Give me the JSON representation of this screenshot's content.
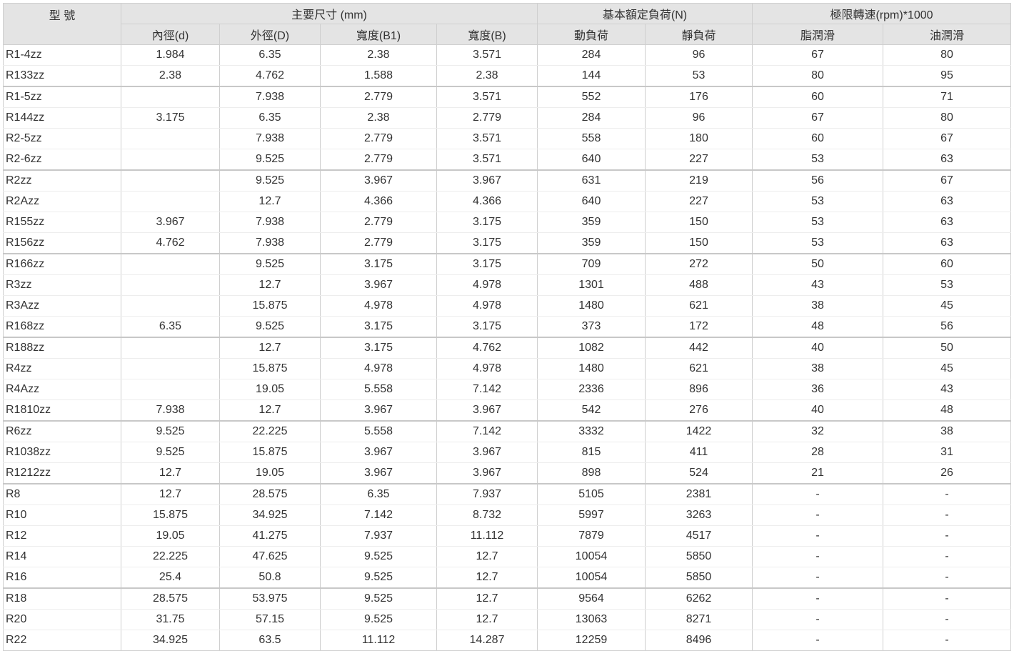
{
  "table": {
    "headers": {
      "model": "型 號",
      "dimensions": "主要尺寸 (mm)",
      "load": "基本額定負荷(N)",
      "speed": "極限轉速(rpm)*1000",
      "inner": "內徑(d)",
      "outer": "外徑(D)",
      "width_b1": "寬度(B1)",
      "width_b": "寬度(B)",
      "dynamic": "動負荷",
      "static": "靜負荷",
      "grease": "脂潤滑",
      "oil": "油潤滑"
    },
    "rows": [
      [
        "R1-4zz",
        "1.984",
        "6.35",
        "2.38",
        "3.571",
        "284",
        "96",
        "67",
        "80"
      ],
      [
        "R133zz",
        "2.38",
        "4.762",
        "1.588",
        "2.38",
        "144",
        "53",
        "80",
        "95"
      ],
      [
        "R1-5zz",
        "",
        "7.938",
        "2.779",
        "3.571",
        "552",
        "176",
        "60",
        "71"
      ],
      [
        "R144zz",
        "3.175",
        "6.35",
        "2.38",
        "2.779",
        "284",
        "96",
        "67",
        "80"
      ],
      [
        "R2-5zz",
        "",
        "7.938",
        "2.779",
        "3.571",
        "558",
        "180",
        "60",
        "67"
      ],
      [
        "R2-6zz",
        "",
        "9.525",
        "2.779",
        "3.571",
        "640",
        "227",
        "53",
        "63"
      ],
      [
        "R2zz",
        "",
        "9.525",
        "3.967",
        "3.967",
        "631",
        "219",
        "56",
        "67"
      ],
      [
        "R2Azz",
        "",
        "12.7",
        "4.366",
        "4.366",
        "640",
        "227",
        "53",
        "63"
      ],
      [
        "R155zz",
        "3.967",
        "7.938",
        "2.779",
        "3.175",
        "359",
        "150",
        "53",
        "63"
      ],
      [
        "R156zz",
        "4.762",
        "7.938",
        "2.779",
        "3.175",
        "359",
        "150",
        "53",
        "63"
      ],
      [
        "R166zz",
        "",
        "9.525",
        "3.175",
        "3.175",
        "709",
        "272",
        "50",
        "60"
      ],
      [
        "R3zz",
        "",
        "12.7",
        "3.967",
        "4.978",
        "1301",
        "488",
        "43",
        "53"
      ],
      [
        "R3Azz",
        "",
        "15.875",
        "4.978",
        "4.978",
        "1480",
        "621",
        "38",
        "45"
      ],
      [
        "R168zz",
        "6.35",
        "9.525",
        "3.175",
        "3.175",
        "373",
        "172",
        "48",
        "56"
      ],
      [
        "R188zz",
        "",
        "12.7",
        "3.175",
        "4.762",
        "1082",
        "442",
        "40",
        "50"
      ],
      [
        "R4zz",
        "",
        "15.875",
        "4.978",
        "4.978",
        "1480",
        "621",
        "38",
        "45"
      ],
      [
        "R4Azz",
        "",
        "19.05",
        "5.558",
        "7.142",
        "2336",
        "896",
        "36",
        "43"
      ],
      [
        "R1810zz",
        "7.938",
        "12.7",
        "3.967",
        "3.967",
        "542",
        "276",
        "40",
        "48"
      ],
      [
        "R6zz",
        "9.525",
        "22.225",
        "5.558",
        "7.142",
        "3332",
        "1422",
        "32",
        "38"
      ],
      [
        "R1038zz",
        "9.525",
        "15.875",
        "3.967",
        "3.967",
        "815",
        "411",
        "28",
        "31"
      ],
      [
        "R1212zz",
        "12.7",
        "19.05",
        "3.967",
        "3.967",
        "898",
        "524",
        "21",
        "26"
      ],
      [
        "R8",
        "12.7",
        "28.575",
        "6.35",
        "7.937",
        "5105",
        "2381",
        "-",
        "-"
      ],
      [
        "R10",
        "15.875",
        "34.925",
        "7.142",
        "8.732",
        "5997",
        "3263",
        "-",
        "-"
      ],
      [
        "R12",
        "19.05",
        "41.275",
        "7.937",
        "11.112",
        "7879",
        "4517",
        "-",
        "-"
      ],
      [
        "R14",
        "22.225",
        "47.625",
        "9.525",
        "12.7",
        "10054",
        "5850",
        "-",
        "-"
      ],
      [
        "R16",
        "25.4",
        "50.8",
        "9.525",
        "12.7",
        "10054",
        "5850",
        "-",
        "-"
      ],
      [
        "R18",
        "28.575",
        "53.975",
        "9.525",
        "12.7",
        "9564",
        "6262",
        "-",
        "-"
      ],
      [
        "R20",
        "31.75",
        "57.15",
        "9.525",
        "12.7",
        "13063",
        "8271",
        "-",
        "-"
      ],
      [
        "R22",
        "34.925",
        "63.5",
        "11.112",
        "14.287",
        "12259",
        "8496",
        "-",
        "-"
      ]
    ]
  }
}
